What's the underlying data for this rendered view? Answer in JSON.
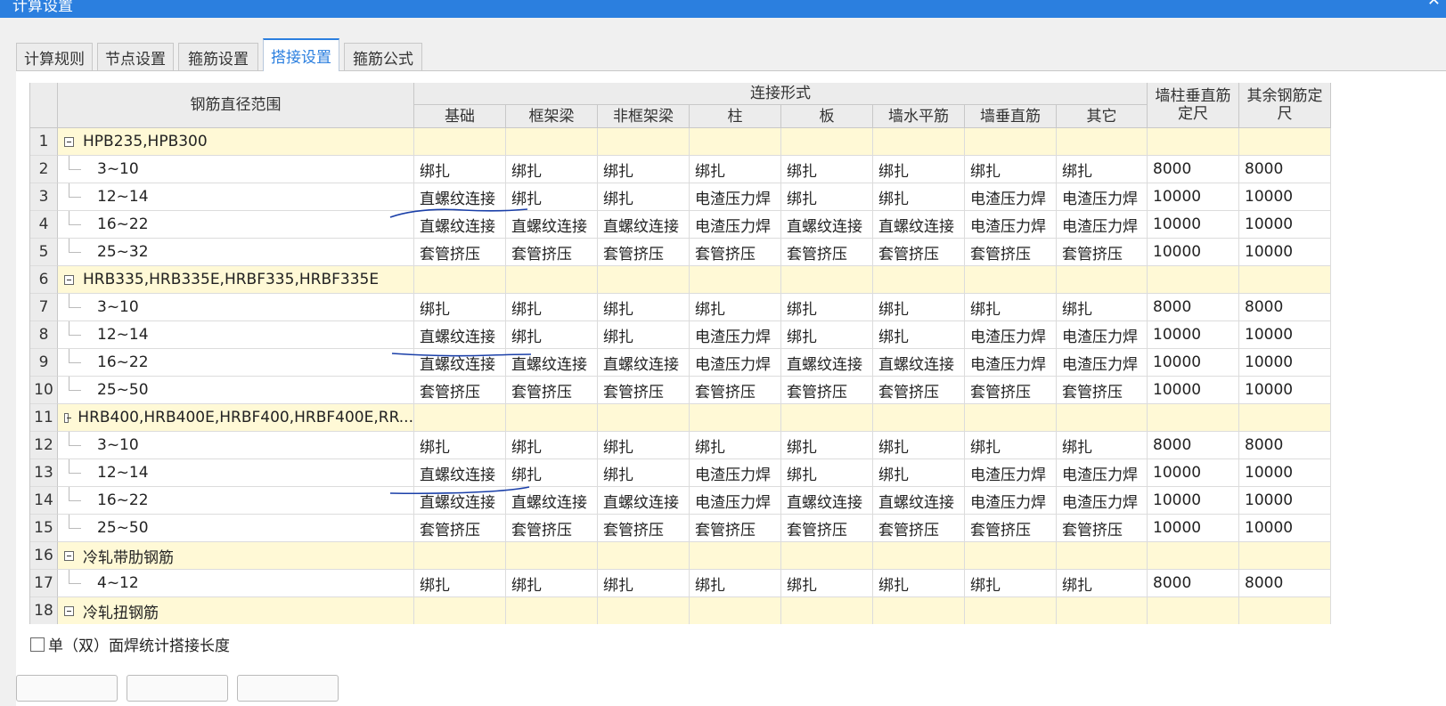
{
  "window": {
    "title": "计算设置"
  },
  "tabs": [
    {
      "label": "计算规则",
      "active": false
    },
    {
      "label": "节点设置",
      "active": false
    },
    {
      "label": "箍筋设置",
      "active": false
    },
    {
      "label": "搭接设置",
      "active": true
    },
    {
      "label": "箍筋公式",
      "active": false
    }
  ],
  "table": {
    "header": {
      "range": "钢筋直径范围",
      "connection_group": "连接形式",
      "columns": [
        "基础",
        "框架梁",
        "非框架梁",
        "柱",
        "板",
        "墙水平筋",
        "墙垂直筋",
        "其它"
      ],
      "wall_length": "墙柱垂直筋定尺",
      "other_length": "其余钢筋定尺"
    },
    "rows": [
      {
        "num": "1",
        "group": true,
        "name": "HPB235,HPB300"
      },
      {
        "num": "2",
        "group": false,
        "name": "3~10",
        "cells": [
          "绑扎",
          "绑扎",
          "绑扎",
          "绑扎",
          "绑扎",
          "绑扎",
          "绑扎",
          "绑扎",
          "8000",
          "8000"
        ]
      },
      {
        "num": "3",
        "group": false,
        "name": "12~14",
        "cells": [
          "直螺纹连接",
          "绑扎",
          "绑扎",
          "电渣压力焊",
          "绑扎",
          "绑扎",
          "电渣压力焊",
          "电渣压力焊",
          "10000",
          "10000"
        ]
      },
      {
        "num": "4",
        "group": false,
        "name": "16~22",
        "cells": [
          "直螺纹连接",
          "直螺纹连接",
          "直螺纹连接",
          "电渣压力焊",
          "直螺纹连接",
          "直螺纹连接",
          "电渣压力焊",
          "电渣压力焊",
          "10000",
          "10000"
        ]
      },
      {
        "num": "5",
        "group": false,
        "name": "25~32",
        "cells": [
          "套管挤压",
          "套管挤压",
          "套管挤压",
          "套管挤压",
          "套管挤压",
          "套管挤压",
          "套管挤压",
          "套管挤压",
          "10000",
          "10000"
        ]
      },
      {
        "num": "6",
        "group": true,
        "name": "HRB335,HRB335E,HRBF335,HRBF335E"
      },
      {
        "num": "7",
        "group": false,
        "name": "3~10",
        "cells": [
          "绑扎",
          "绑扎",
          "绑扎",
          "绑扎",
          "绑扎",
          "绑扎",
          "绑扎",
          "绑扎",
          "8000",
          "8000"
        ]
      },
      {
        "num": "8",
        "group": false,
        "name": "12~14",
        "cells": [
          "直螺纹连接",
          "绑扎",
          "绑扎",
          "电渣压力焊",
          "绑扎",
          "绑扎",
          "电渣压力焊",
          "电渣压力焊",
          "10000",
          "10000"
        ]
      },
      {
        "num": "9",
        "group": false,
        "name": "16~22",
        "cells": [
          "直螺纹连接",
          "直螺纹连接",
          "直螺纹连接",
          "电渣压力焊",
          "直螺纹连接",
          "直螺纹连接",
          "电渣压力焊",
          "电渣压力焊",
          "10000",
          "10000"
        ]
      },
      {
        "num": "10",
        "group": false,
        "name": "25~50",
        "cells": [
          "套管挤压",
          "套管挤压",
          "套管挤压",
          "套管挤压",
          "套管挤压",
          "套管挤压",
          "套管挤压",
          "套管挤压",
          "10000",
          "10000"
        ]
      },
      {
        "num": "11",
        "group": true,
        "name": "HRB400,HRB400E,HRBF400,HRBF400E,RR..."
      },
      {
        "num": "12",
        "group": false,
        "name": "3~10",
        "cells": [
          "绑扎",
          "绑扎",
          "绑扎",
          "绑扎",
          "绑扎",
          "绑扎",
          "绑扎",
          "绑扎",
          "8000",
          "8000"
        ]
      },
      {
        "num": "13",
        "group": false,
        "name": "12~14",
        "cells": [
          "直螺纹连接",
          "绑扎",
          "绑扎",
          "电渣压力焊",
          "绑扎",
          "绑扎",
          "电渣压力焊",
          "电渣压力焊",
          "10000",
          "10000"
        ]
      },
      {
        "num": "14",
        "group": false,
        "name": "16~22",
        "cells": [
          "直螺纹连接",
          "直螺纹连接",
          "直螺纹连接",
          "电渣压力焊",
          "直螺纹连接",
          "直螺纹连接",
          "电渣压力焊",
          "电渣压力焊",
          "10000",
          "10000"
        ]
      },
      {
        "num": "15",
        "group": false,
        "name": "25~50",
        "cells": [
          "套管挤压",
          "套管挤压",
          "套管挤压",
          "套管挤压",
          "套管挤压",
          "套管挤压",
          "套管挤压",
          "套管挤压",
          "10000",
          "10000"
        ]
      },
      {
        "num": "16",
        "group": true,
        "name": "冷轧带肋钢筋"
      },
      {
        "num": "17",
        "group": false,
        "name": "4~12",
        "cells": [
          "绑扎",
          "绑扎",
          "绑扎",
          "绑扎",
          "绑扎",
          "绑扎",
          "绑扎",
          "绑扎",
          "8000",
          "8000"
        ]
      },
      {
        "num": "18",
        "group": true,
        "name": "冷轧扭钢筋"
      }
    ]
  },
  "footer": {
    "checkbox_label": "单（双）面焊统计搭接长度",
    "checked": false
  },
  "colors": {
    "titlebar": "#2b7fdf",
    "group_row": "#fff9d6",
    "annotation": "#1a3fa8"
  }
}
